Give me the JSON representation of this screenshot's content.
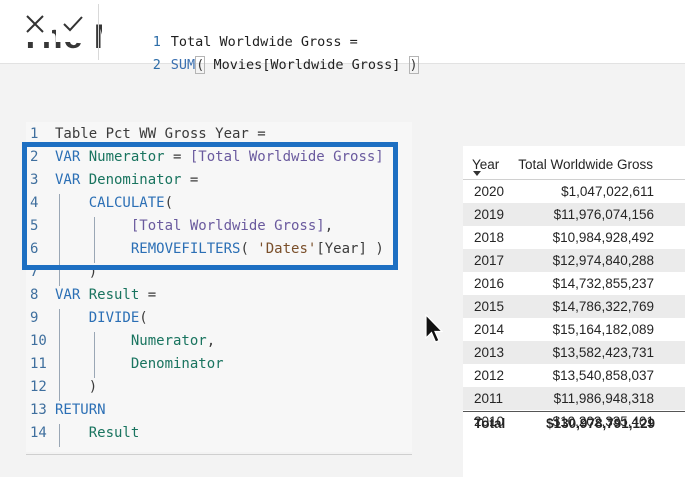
{
  "formula_bar": {
    "lines": [
      {
        "num": "1",
        "text": "Total Worldwide Gross ="
      },
      {
        "num": "2",
        "fn": "SUM",
        "open": "(",
        "arg": " Movies[Worldwide Gross] ",
        "close": ")"
      }
    ],
    "background_title": "The M"
  },
  "editor": {
    "lines": [
      {
        "num": "1",
        "tokens": [
          {
            "t": "Table Pct WW Gross Year =",
            "c": "plain"
          }
        ]
      },
      {
        "num": "2",
        "tokens": [
          {
            "t": "VAR ",
            "c": "kw"
          },
          {
            "t": "Numerator",
            "c": "var"
          },
          {
            "t": " = ",
            "c": "plain"
          },
          {
            "t": "[Total Worldwide Gross]",
            "c": "meas"
          }
        ]
      },
      {
        "num": "3",
        "tokens": [
          {
            "t": "VAR ",
            "c": "kw"
          },
          {
            "t": "Denominator",
            "c": "var"
          },
          {
            "t": " =",
            "c": "plain"
          }
        ]
      },
      {
        "num": "4",
        "tokens": [
          {
            "t": "    ",
            "c": "plain"
          },
          {
            "t": "CALCULATE",
            "c": "fn"
          },
          {
            "t": "(",
            "c": "plain"
          }
        ]
      },
      {
        "num": "5",
        "tokens": [
          {
            "t": "         ",
            "c": "plain"
          },
          {
            "t": "[Total Worldwide Gross]",
            "c": "meas"
          },
          {
            "t": ",",
            "c": "plain"
          }
        ]
      },
      {
        "num": "6",
        "tokens": [
          {
            "t": "         ",
            "c": "plain"
          },
          {
            "t": "REMOVEFILTERS",
            "c": "fn"
          },
          {
            "t": "( ",
            "c": "plain"
          },
          {
            "t": "'Dates'",
            "c": "str"
          },
          {
            "t": "[Year] )",
            "c": "plain"
          }
        ]
      },
      {
        "num": "7",
        "tokens": [
          {
            "t": "    )",
            "c": "plain"
          }
        ]
      },
      {
        "num": "8",
        "tokens": [
          {
            "t": "VAR ",
            "c": "kw"
          },
          {
            "t": "Result",
            "c": "var"
          },
          {
            "t": " =",
            "c": "plain"
          }
        ]
      },
      {
        "num": "9",
        "tokens": [
          {
            "t": "    ",
            "c": "plain"
          },
          {
            "t": "DIVIDE",
            "c": "fn"
          },
          {
            "t": "(",
            "c": "plain"
          }
        ]
      },
      {
        "num": "10",
        "tokens": [
          {
            "t": "         ",
            "c": "plain"
          },
          {
            "t": "Numerator",
            "c": "var"
          },
          {
            "t": ",",
            "c": "plain"
          }
        ]
      },
      {
        "num": "11",
        "tokens": [
          {
            "t": "         ",
            "c": "plain"
          },
          {
            "t": "Denominator",
            "c": "var"
          }
        ]
      },
      {
        "num": "12",
        "tokens": [
          {
            "t": "    )",
            "c": "plain"
          }
        ]
      },
      {
        "num": "13",
        "tokens": [
          {
            "t": "RETURN",
            "c": "kw"
          }
        ]
      },
      {
        "num": "14",
        "tokens": [
          {
            "t": "    ",
            "c": "plain"
          },
          {
            "t": "Result",
            "c": "var"
          }
        ]
      }
    ]
  },
  "table": {
    "headers": {
      "year": "Year",
      "gross": "Total Worldwide Gross"
    },
    "rows": [
      {
        "year": "2020",
        "value": "$1,047,022,611"
      },
      {
        "year": "2019",
        "value": "$11,976,074,156"
      },
      {
        "year": "2018",
        "value": "$10,984,928,492"
      },
      {
        "year": "2017",
        "value": "$12,974,840,288"
      },
      {
        "year": "2016",
        "value": "$14,732,855,237"
      },
      {
        "year": "2015",
        "value": "$14,786,322,769"
      },
      {
        "year": "2014",
        "value": "$15,164,182,089"
      },
      {
        "year": "2013",
        "value": "$13,582,423,731"
      },
      {
        "year": "2012",
        "value": "$13,540,858,037"
      },
      {
        "year": "2011",
        "value": "$11,986,948,318"
      },
      {
        "year": "2010",
        "value": "$10,202,335,401"
      }
    ],
    "total": {
      "label": "Total",
      "value": "$130,978,791,129"
    }
  },
  "colors": {
    "highlight_border": "#1d6fc2"
  }
}
